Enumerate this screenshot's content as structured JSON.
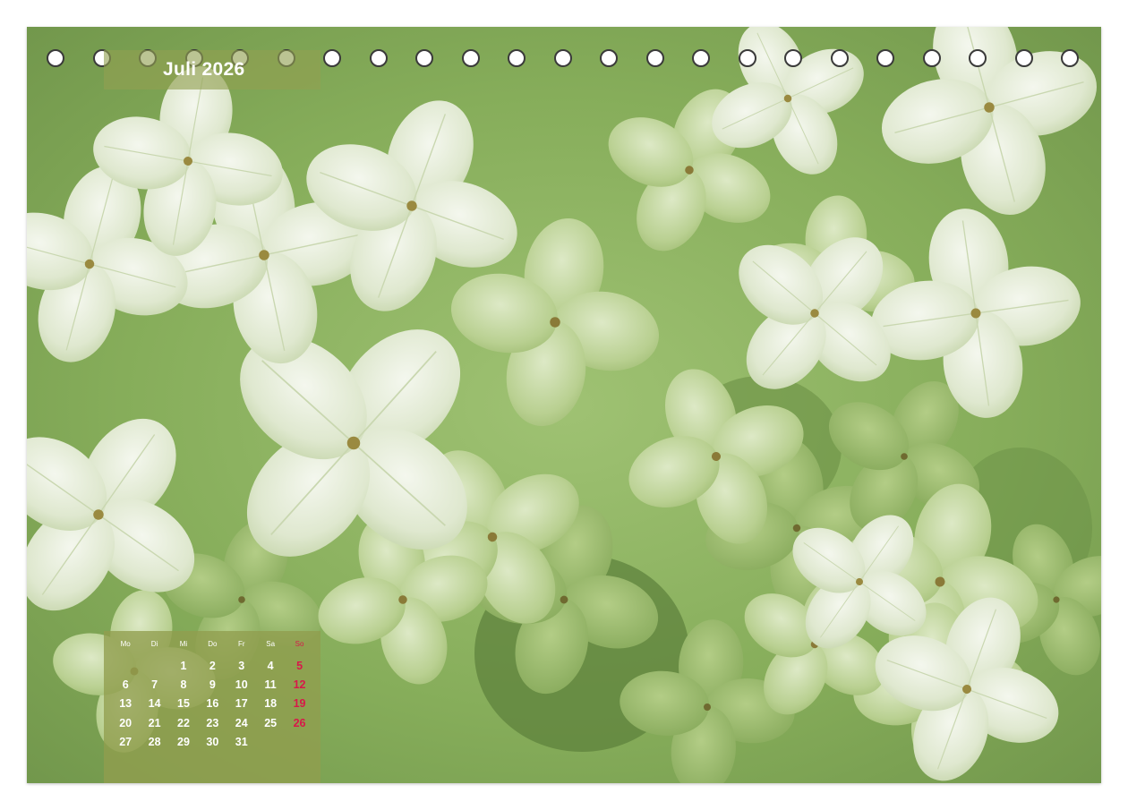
{
  "calendar_page": {
    "title": "Juli 2026",
    "weekdays": [
      "Mo",
      "Di",
      "Mi",
      "Do",
      "Fr",
      "Sa",
      "So"
    ],
    "weeks": [
      [
        "",
        "",
        "1",
        "2",
        "3",
        "4",
        "5"
      ],
      [
        "6",
        "7",
        "8",
        "9",
        "10",
        "11",
        "12"
      ],
      [
        "13",
        "14",
        "15",
        "16",
        "17",
        "18",
        "19"
      ],
      [
        "20",
        "21",
        "22",
        "23",
        "24",
        "25",
        "26"
      ],
      [
        "27",
        "28",
        "29",
        "30",
        "31",
        "",
        ""
      ]
    ],
    "sunday_color": "#d8184a",
    "panel_color": "#919e4e"
  },
  "photo": {
    "subject_icon": "hydrangea-flowers-photo"
  },
  "binding": {
    "hole_count": 23
  }
}
